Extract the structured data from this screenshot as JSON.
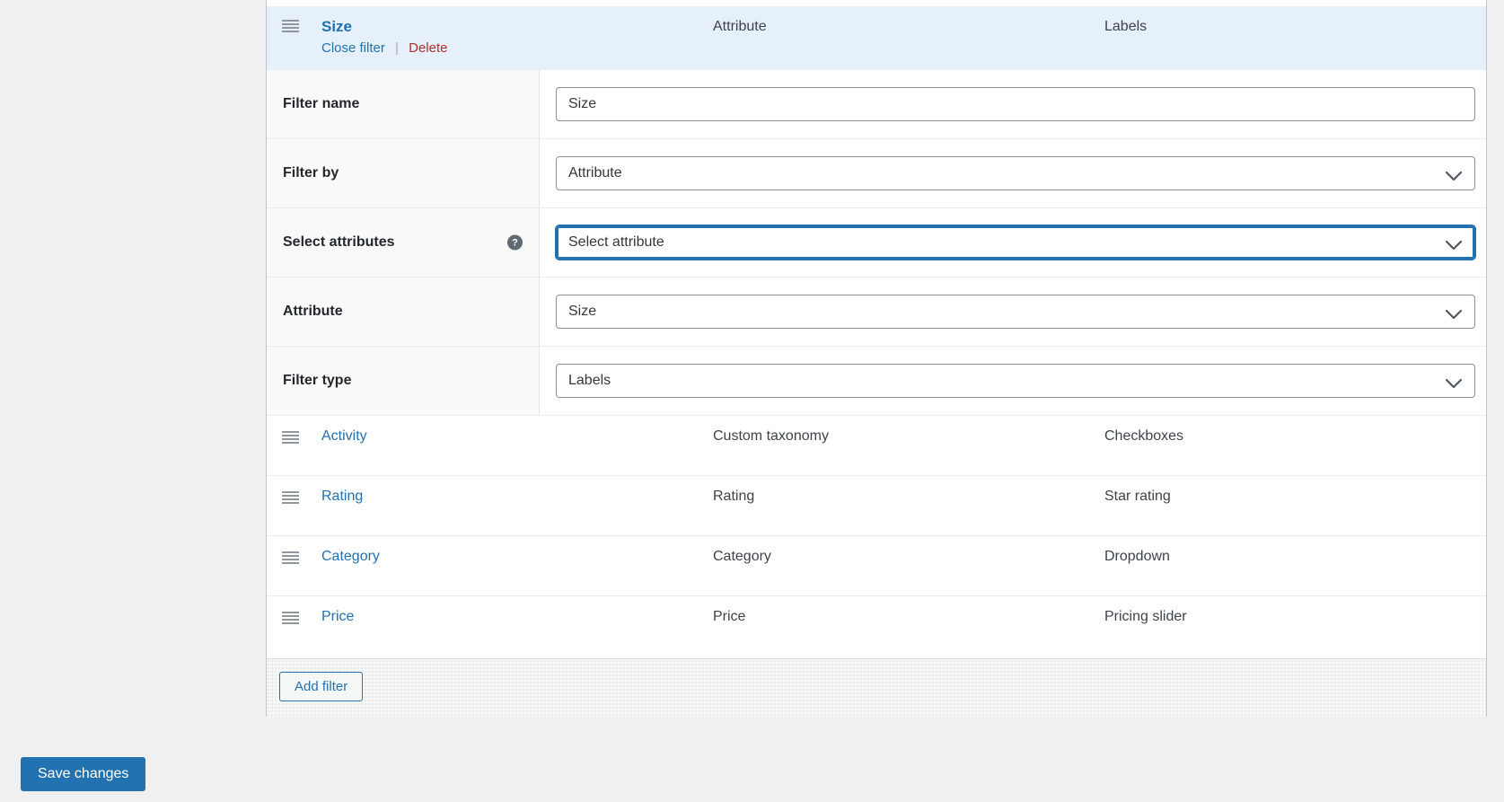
{
  "colors": {
    "accent_blue": "#2271b1",
    "delete_red": "#b32d2e",
    "header_bg": "#e6f0fa",
    "page_bg": "#f0f0f1"
  },
  "open_filter": {
    "title": "Size",
    "close_action": "Close filter",
    "action_separator": "|",
    "delete_action": "Delete",
    "col_attribute": "Attribute",
    "col_labels": "Labels",
    "fields": {
      "filter_name": {
        "label": "Filter name",
        "value": "Size"
      },
      "filter_by": {
        "label": "Filter by",
        "value": "Attribute"
      },
      "select_attributes": {
        "label": "Select attributes",
        "value": "Select attribute",
        "help_glyph": "?"
      },
      "attribute": {
        "label": "Attribute",
        "value": "Size"
      },
      "filter_type": {
        "label": "Filter type",
        "value": "Labels"
      }
    }
  },
  "filter_rows": [
    {
      "name": "Activity",
      "attribute": "Custom taxonomy",
      "labels": "Checkboxes"
    },
    {
      "name": "Rating",
      "attribute": "Rating",
      "labels": "Star rating"
    },
    {
      "name": "Category",
      "attribute": "Category",
      "labels": "Dropdown"
    },
    {
      "name": "Price",
      "attribute": "Price",
      "labels": "Pricing slider"
    }
  ],
  "footer": {
    "add_filter": "Add filter"
  },
  "actions": {
    "save_changes": "Save changes"
  }
}
